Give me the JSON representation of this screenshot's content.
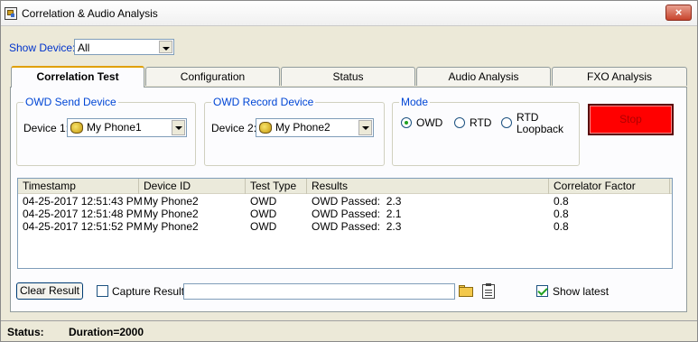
{
  "window": {
    "title": "Correlation & Audio Analysis",
    "close_glyph": "×"
  },
  "show_device": {
    "label": "Show Device:",
    "value": "All"
  },
  "tabs": [
    {
      "label": "Correlation Test",
      "active": true
    },
    {
      "label": "Configuration",
      "active": false
    },
    {
      "label": "Status",
      "active": false
    },
    {
      "label": "Audio Analysis",
      "active": false
    },
    {
      "label": "FXO Analysis",
      "active": false
    }
  ],
  "owd_send": {
    "title": "OWD Send Device",
    "device_label": "Device 1:",
    "device_value": "My Phone1"
  },
  "owd_record": {
    "title": "OWD Record Device",
    "device_label": "Device 2:",
    "device_value": "My Phone2"
  },
  "mode": {
    "title": "Mode",
    "options": [
      {
        "label": "OWD",
        "checked": true
      },
      {
        "label": "RTD",
        "checked": false
      },
      {
        "label": "RTD\nLoopback",
        "checked": false
      }
    ]
  },
  "stop_button": {
    "label": "Stop",
    "color": "#ff0000"
  },
  "results_table": {
    "columns": [
      "Timestamp",
      "Device ID",
      "Test Type",
      "Results",
      "Correlator Factor"
    ],
    "rows": [
      [
        "04-25-2017 12:51:43 PM",
        "My Phone2",
        "OWD",
        "OWD Passed:  2.3",
        "0.8"
      ],
      [
        "04-25-2017 12:51:48 PM",
        "My Phone2",
        "OWD",
        "OWD Passed:  2.1",
        "0.8"
      ],
      [
        "04-25-2017 12:51:52 PM",
        "My Phone2",
        "OWD",
        "OWD Passed:  2.3",
        "0.8"
      ]
    ]
  },
  "bottom": {
    "clear_result_label": "Clear Result",
    "capture_result_label": "Capture Result",
    "capture_result_checked": false,
    "capture_path_value": "",
    "show_latest_label": "Show latest",
    "show_latest_checked": true
  },
  "status_bar": {
    "label": "Status:",
    "value": "Duration=2000"
  },
  "icons": {
    "app": "app-icon",
    "phone": "phone-icon",
    "folder": "folder-open-icon",
    "clipboard": "clipboard-icon"
  },
  "colors": {
    "accent_blue": "#0046d5",
    "tab_highlight": "#e0a000",
    "stop_red": "#ff0000"
  }
}
